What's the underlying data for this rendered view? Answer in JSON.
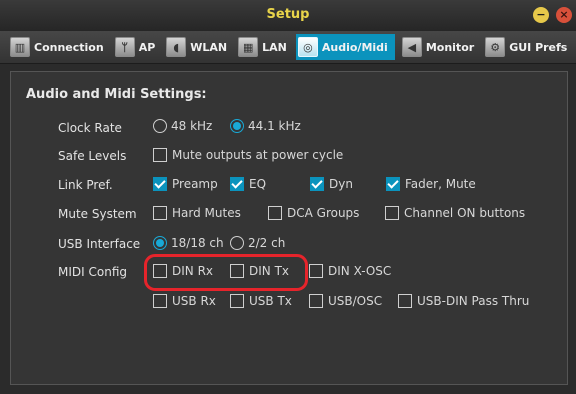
{
  "window": {
    "title": "Setup"
  },
  "tabs": [
    {
      "label": "Connection",
      "icon": "mixer-icon",
      "active": false
    },
    {
      "label": "AP",
      "icon": "access-point-icon",
      "active": false
    },
    {
      "label": "WLAN",
      "icon": "wifi-icon",
      "active": false
    },
    {
      "label": "LAN",
      "icon": "ethernet-icon",
      "active": false
    },
    {
      "label": "Audio/Midi",
      "icon": "midi-din-icon",
      "active": true
    },
    {
      "label": "Monitor",
      "icon": "speaker-icon",
      "active": false
    },
    {
      "label": "GUI Prefs",
      "icon": "gears-icon",
      "active": false
    }
  ],
  "section_title": "Audio and Midi Settings:",
  "settings": {
    "clock_rate": {
      "label": "Clock Rate",
      "options": [
        "48 kHz",
        "44.1 kHz"
      ],
      "selected": "44.1 kHz"
    },
    "safe_levels": {
      "label": "Safe Levels",
      "option": "Mute outputs at power cycle",
      "checked": false
    },
    "link_pref": {
      "label": "Link Pref.",
      "options": [
        {
          "text": "Preamp",
          "checked": true
        },
        {
          "text": "EQ",
          "checked": true
        },
        {
          "text": "Dyn",
          "checked": true
        },
        {
          "text": "Fader, Mute",
          "checked": true
        }
      ]
    },
    "mute_system": {
      "label": "Mute System",
      "options": [
        {
          "text": "Hard Mutes",
          "checked": false
        },
        {
          "text": "DCA Groups",
          "checked": false
        },
        {
          "text": "Channel ON buttons",
          "checked": false
        }
      ]
    },
    "usb_interface": {
      "label": "USB Interface",
      "options": [
        "18/18 ch",
        "2/2 ch"
      ],
      "selected": "18/18 ch"
    },
    "midi_config": {
      "label": "MIDI Config",
      "options": [
        {
          "text": "DIN Rx",
          "checked": false
        },
        {
          "text": "DIN Tx",
          "checked": false
        },
        {
          "text": "DIN X-OSC",
          "checked": false
        },
        {
          "text": "USB Rx",
          "checked": false
        },
        {
          "text": "USB Tx",
          "checked": false
        },
        {
          "text": "USB/OSC",
          "checked": false
        },
        {
          "text": "USB-DIN Pass Thru",
          "checked": false
        }
      ]
    }
  },
  "colors": {
    "accent": "#0b93bd",
    "title": "#e8d44a",
    "highlight": "#e6242b"
  }
}
